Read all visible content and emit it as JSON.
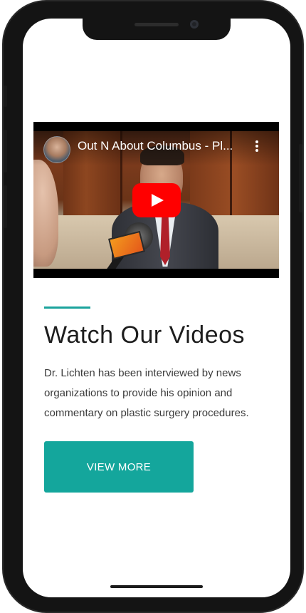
{
  "video": {
    "title": "Out N About Columbus - Pl...",
    "play_icon": "youtube-play-icon",
    "menu_icon": "more-vert-icon"
  },
  "section": {
    "heading": "Watch Our Videos",
    "description": "Dr. Lichten has been interviewed by news organizations to provide his opinion and commentary on plastic surgery procedures.",
    "button_label": "VIEW MORE"
  },
  "colors": {
    "accent": "#14a69c",
    "youtube_red": "#ff0000"
  }
}
